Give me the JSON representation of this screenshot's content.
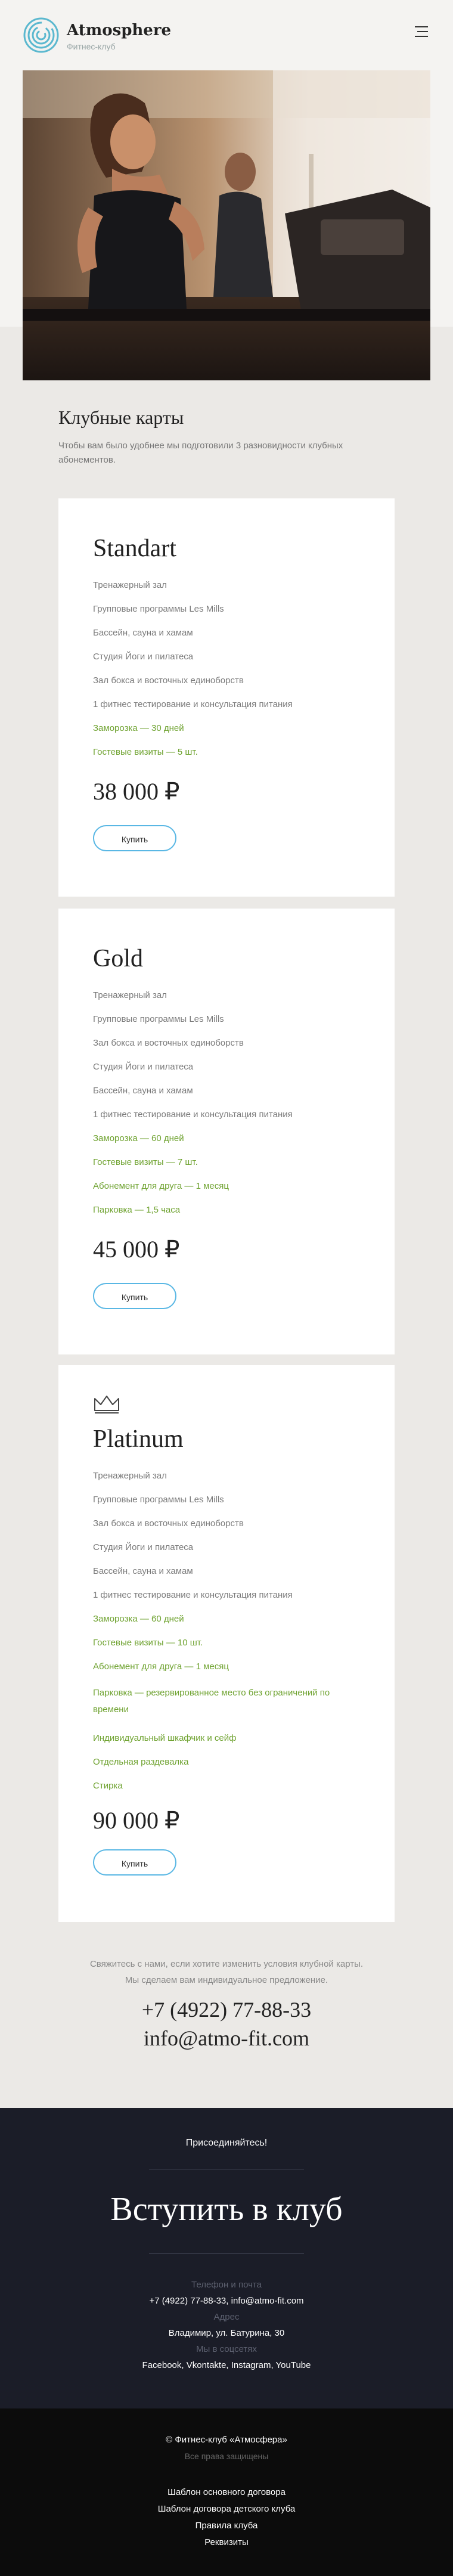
{
  "header": {
    "brand": "Atmosphere",
    "brand_sub": "Фитнес-клуб",
    "menu_icon": "menu-icon"
  },
  "hero": {
    "image": "woman-on-treadmill-photo"
  },
  "cards_section": {
    "title": "Клубные карты",
    "subtitle": "Чтобы вам было удобнее мы подготовили 3 разновидности клубных абонементов."
  },
  "plans": [
    {
      "name": "Standart",
      "features": [
        {
          "text": "Тренажерный зал",
          "highlight": false
        },
        {
          "text": "Групповые программы Les Mills",
          "highlight": false
        },
        {
          "text": "Бассейн, сауна и хамам",
          "highlight": false
        },
        {
          "text": "Студия Йоги и пилатеса",
          "highlight": false
        },
        {
          "text": "Зал бокса и восточных единоборств",
          "highlight": false
        },
        {
          "text": "1 фитнес тестирование и консультация питания",
          "highlight": false
        },
        {
          "text": "Заморозка — 30 дней",
          "highlight": true
        },
        {
          "text": "Гостевые визиты — 5 шт.",
          "highlight": true
        }
      ],
      "price": "38 000 ₽",
      "button": "Купить"
    },
    {
      "name": "Gold",
      "features": [
        {
          "text": "Тренажерный зал",
          "highlight": false
        },
        {
          "text": "Групповые программы Les Mills",
          "highlight": false
        },
        {
          "text": "Зал бокса и восточных единоборств",
          "highlight": false
        },
        {
          "text": "Студия Йоги и пилатеса",
          "highlight": false
        },
        {
          "text": "Бассейн, сауна и хамам",
          "highlight": false
        },
        {
          "text": "1 фитнес тестирование и консультация питания",
          "highlight": false
        },
        {
          "text": "Заморозка — 60 дней",
          "highlight": true
        },
        {
          "text": "Гостевые визиты — 7 шт.",
          "highlight": true
        },
        {
          "text": "Абонемент для друга — 1 месяц",
          "highlight": true
        },
        {
          "text": "Парковка — 1,5 часа",
          "highlight": true
        }
      ],
      "price": "45 000 ₽",
      "button": "Купить"
    },
    {
      "name": "Platinum",
      "icon": "crown-icon",
      "features": [
        {
          "text": "Тренажерный зал",
          "highlight": false
        },
        {
          "text": "Групповые программы Les Mills",
          "highlight": false
        },
        {
          "text": "Зал бокса и восточных единоборств",
          "highlight": false
        },
        {
          "text": "Студия Йоги и пилатеса",
          "highlight": false
        },
        {
          "text": "Бассейн, сауна и хамам",
          "highlight": false
        },
        {
          "text": "1 фитнес тестирование и консультация питания",
          "highlight": false
        },
        {
          "text": "Заморозка — 60 дней",
          "highlight": true
        },
        {
          "text": "Гостевые визиты — 10 шт.",
          "highlight": true
        },
        {
          "text": "Абонемент для друга — 1 месяц",
          "highlight": true
        },
        {
          "text": "Парковка — резервированное место без ограничений по времени",
          "highlight": true
        },
        {
          "text": "Индивидуальный шкафчик и сейф",
          "highlight": true
        },
        {
          "text": "Отдельная раздевалка",
          "highlight": true
        },
        {
          "text": "Стирка",
          "highlight": true
        }
      ],
      "price": "90 000 ₽",
      "button": "Купить"
    }
  ],
  "contact": {
    "note_line1": "Свяжитесь с нами, если хотите изменить условия клубной карты.",
    "note_line2": "Мы сделаем вам индивидуальное предложение.",
    "phone": "+7 (4922) 77-88-33",
    "email": "info@atmo-fit.com"
  },
  "join": {
    "label": "Присоединяйтесь!",
    "title": "Вступить в клуб",
    "contacts_label": "Телефон и почта",
    "contacts_value": "+7 (4922) 77-88-33, info@atmo-fit.com",
    "address_label": "Адрес",
    "address_value": "Владимир, ул. Батурина, 30",
    "social_label": "Мы в соцсетях",
    "social_value": "Facebook, Vkontakte, Instagram, YouTube"
  },
  "footer": {
    "copyright": "© Фитнес-клуб «Атмосфера»",
    "rights": "Все права защищены",
    "links": [
      "Шаблон основного договора",
      "Шаблон договора детского клуба",
      "Правила клуба",
      "Реквизиты"
    ]
  },
  "colors": {
    "accent_green": "#6ea22f",
    "button_border": "#59b7e4",
    "dark_section": "#1b1d28",
    "footer": "#0c0c0c"
  }
}
